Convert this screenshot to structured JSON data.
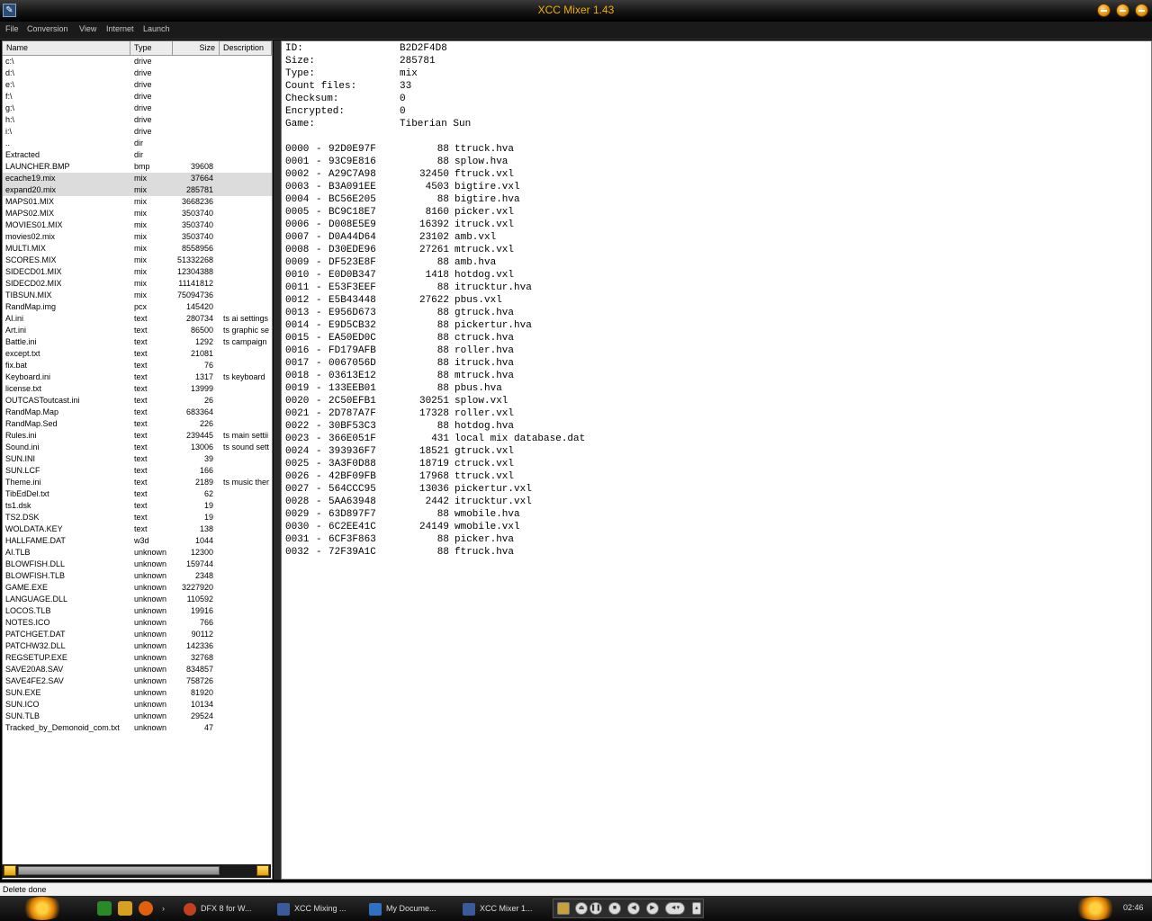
{
  "window": {
    "title": "XCC Mixer 1.43",
    "app_icon": "xcc-app-icon",
    "buttons": [
      "minimize-button",
      "maximize-button",
      "close-button"
    ]
  },
  "menu": [
    "File",
    "Conversion",
    "View",
    "Internet",
    "Launch"
  ],
  "file_list": {
    "columns": [
      "Name",
      "Type",
      "Size",
      "Description"
    ],
    "rows": [
      {
        "name": "c:\\",
        "type": "drive",
        "size": "",
        "desc": ""
      },
      {
        "name": "d:\\",
        "type": "drive",
        "size": "",
        "desc": ""
      },
      {
        "name": "e:\\",
        "type": "drive",
        "size": "",
        "desc": ""
      },
      {
        "name": "f:\\",
        "type": "drive",
        "size": "",
        "desc": ""
      },
      {
        "name": "g:\\",
        "type": "drive",
        "size": "",
        "desc": ""
      },
      {
        "name": "h:\\",
        "type": "drive",
        "size": "",
        "desc": ""
      },
      {
        "name": "i:\\",
        "type": "drive",
        "size": "",
        "desc": ""
      },
      {
        "name": "..",
        "type": "dir",
        "size": "",
        "desc": ""
      },
      {
        "name": "Extracted",
        "type": "dir",
        "size": "",
        "desc": ""
      },
      {
        "name": "LAUNCHER.BMP",
        "type": "bmp",
        "size": "39608",
        "desc": ""
      },
      {
        "name": "ecache19.mix",
        "type": "mix",
        "size": "37664",
        "desc": "",
        "selected": true
      },
      {
        "name": "expand20.mix",
        "type": "mix",
        "size": "285781",
        "desc": "",
        "selected": true
      },
      {
        "name": "MAPS01.MIX",
        "type": "mix",
        "size": "3668236",
        "desc": ""
      },
      {
        "name": "MAPS02.MIX",
        "type": "mix",
        "size": "3503740",
        "desc": ""
      },
      {
        "name": "MOVIES01.MIX",
        "type": "mix",
        "size": "3503740",
        "desc": ""
      },
      {
        "name": "movies02.mix",
        "type": "mix",
        "size": "3503740",
        "desc": ""
      },
      {
        "name": "MULTI.MIX",
        "type": "mix",
        "size": "8558956",
        "desc": ""
      },
      {
        "name": "SCORES.MIX",
        "type": "mix",
        "size": "51332268",
        "desc": ""
      },
      {
        "name": "SIDECD01.MIX",
        "type": "mix",
        "size": "12304388",
        "desc": ""
      },
      {
        "name": "SIDECD02.MIX",
        "type": "mix",
        "size": "11141812",
        "desc": ""
      },
      {
        "name": "TIBSUN.MIX",
        "type": "mix",
        "size": "75094736",
        "desc": ""
      },
      {
        "name": "RandMap.img",
        "type": "pcx",
        "size": "145420",
        "desc": ""
      },
      {
        "name": "AI.ini",
        "type": "text",
        "size": "280734",
        "desc": "ts ai settings"
      },
      {
        "name": "Art.ini",
        "type": "text",
        "size": "86500",
        "desc": "ts graphic se"
      },
      {
        "name": "Battle.ini",
        "type": "text",
        "size": "1292",
        "desc": "ts campaign"
      },
      {
        "name": "except.txt",
        "type": "text",
        "size": "21081",
        "desc": ""
      },
      {
        "name": "fix.bat",
        "type": "text",
        "size": "76",
        "desc": ""
      },
      {
        "name": "Keyboard.ini",
        "type": "text",
        "size": "1317",
        "desc": "ts keyboard"
      },
      {
        "name": "license.txt",
        "type": "text",
        "size": "13999",
        "desc": ""
      },
      {
        "name": "OUTCASToutcast.ini",
        "type": "text",
        "size": "26",
        "desc": ""
      },
      {
        "name": "RandMap.Map",
        "type": "text",
        "size": "683364",
        "desc": ""
      },
      {
        "name": "RandMap.Sed",
        "type": "text",
        "size": "226",
        "desc": ""
      },
      {
        "name": "Rules.ini",
        "type": "text",
        "size": "239445",
        "desc": "ts main settii"
      },
      {
        "name": "Sound.ini",
        "type": "text",
        "size": "13006",
        "desc": "ts sound sett"
      },
      {
        "name": "SUN.INI",
        "type": "text",
        "size": "39",
        "desc": ""
      },
      {
        "name": "SUN.LCF",
        "type": "text",
        "size": "166",
        "desc": ""
      },
      {
        "name": "Theme.ini",
        "type": "text",
        "size": "2189",
        "desc": "ts music ther"
      },
      {
        "name": "TibEdDel.txt",
        "type": "text",
        "size": "62",
        "desc": ""
      },
      {
        "name": "ts1.dsk",
        "type": "text",
        "size": "19",
        "desc": ""
      },
      {
        "name": "TS2.DSK",
        "type": "text",
        "size": "19",
        "desc": ""
      },
      {
        "name": "WOLDATA.KEY",
        "type": "text",
        "size": "138",
        "desc": ""
      },
      {
        "name": "HALLFAME.DAT",
        "type": "w3d",
        "size": "1044",
        "desc": ""
      },
      {
        "name": "AI.TLB",
        "type": "unknown",
        "size": "12300",
        "desc": ""
      },
      {
        "name": "BLOWFISH.DLL",
        "type": "unknown",
        "size": "159744",
        "desc": ""
      },
      {
        "name": "BLOWFISH.TLB",
        "type": "unknown",
        "size": "2348",
        "desc": ""
      },
      {
        "name": "GAME.EXE",
        "type": "unknown",
        "size": "3227920",
        "desc": ""
      },
      {
        "name": "LANGUAGE.DLL",
        "type": "unknown",
        "size": "110592",
        "desc": ""
      },
      {
        "name": "LOCOS.TLB",
        "type": "unknown",
        "size": "19916",
        "desc": ""
      },
      {
        "name": "NOTES.ICO",
        "type": "unknown",
        "size": "766",
        "desc": ""
      },
      {
        "name": "PATCHGET.DAT",
        "type": "unknown",
        "size": "90112",
        "desc": ""
      },
      {
        "name": "PATCHW32.DLL",
        "type": "unknown",
        "size": "142336",
        "desc": ""
      },
      {
        "name": "REGSETUP.EXE",
        "type": "unknown",
        "size": "32768",
        "desc": ""
      },
      {
        "name": "SAVE20A8.SAV",
        "type": "unknown",
        "size": "834857",
        "desc": ""
      },
      {
        "name": "SAVE4FE2.SAV",
        "type": "unknown",
        "size": "758726",
        "desc": ""
      },
      {
        "name": "SUN.EXE",
        "type": "unknown",
        "size": "81920",
        "desc": ""
      },
      {
        "name": "SUN.ICO",
        "type": "unknown",
        "size": "10134",
        "desc": ""
      },
      {
        "name": "SUN.TLB",
        "type": "unknown",
        "size": "29524",
        "desc": ""
      },
      {
        "name": "Tracked_by_Demonoid_com.txt",
        "type": "unknown",
        "size": "47",
        "desc": ""
      }
    ]
  },
  "details": {
    "info": [
      {
        "label": "ID:",
        "value": "B2D2F4D8"
      },
      {
        "label": "Size:",
        "value": "285781"
      },
      {
        "label": "Type:",
        "value": "mix"
      },
      {
        "label": "Count files:",
        "value": "33"
      },
      {
        "label": "Checksum:",
        "value": "0"
      },
      {
        "label": "Encrypted:",
        "value": "0"
      },
      {
        "label": "Game:",
        "value": "Tiberian Sun"
      }
    ],
    "entries": [
      {
        "idx": "0000",
        "id": "92D0E97F",
        "size": "88",
        "name": "ttruck.hva"
      },
      {
        "idx": "0001",
        "id": "93C9E816",
        "size": "88",
        "name": "splow.hva"
      },
      {
        "idx": "0002",
        "id": "A29C7A98",
        "size": "32450",
        "name": "ftruck.vxl"
      },
      {
        "idx": "0003",
        "id": "B3A091EE",
        "size": "4503",
        "name": "bigtire.vxl"
      },
      {
        "idx": "0004",
        "id": "BC56E205",
        "size": "88",
        "name": "bigtire.hva"
      },
      {
        "idx": "0005",
        "id": "BC9C18E7",
        "size": "8160",
        "name": "picker.vxl"
      },
      {
        "idx": "0006",
        "id": "D008E5E9",
        "size": "16392",
        "name": "itruck.vxl"
      },
      {
        "idx": "0007",
        "id": "D0A44D64",
        "size": "23102",
        "name": "amb.vxl"
      },
      {
        "idx": "0008",
        "id": "D30EDE96",
        "size": "27261",
        "name": "mtruck.vxl"
      },
      {
        "idx": "0009",
        "id": "DF523E8F",
        "size": "88",
        "name": "amb.hva"
      },
      {
        "idx": "0010",
        "id": "E0D0B347",
        "size": "1418",
        "name": "hotdog.vxl"
      },
      {
        "idx": "0011",
        "id": "E53F3EEF",
        "size": "88",
        "name": "itrucktur.hva"
      },
      {
        "idx": "0012",
        "id": "E5B43448",
        "size": "27622",
        "name": "pbus.vxl"
      },
      {
        "idx": "0013",
        "id": "E956D673",
        "size": "88",
        "name": "gtruck.hva"
      },
      {
        "idx": "0014",
        "id": "E9D5CB32",
        "size": "88",
        "name": "pickertur.hva"
      },
      {
        "idx": "0015",
        "id": "EA50ED0C",
        "size": "88",
        "name": "ctruck.hva"
      },
      {
        "idx": "0016",
        "id": "FD179AFB",
        "size": "88",
        "name": "roller.hva"
      },
      {
        "idx": "0017",
        "id": "0067056D",
        "size": "88",
        "name": "itruck.hva"
      },
      {
        "idx": "0018",
        "id": "03613E12",
        "size": "88",
        "name": "mtruck.hva"
      },
      {
        "idx": "0019",
        "id": "133EEB01",
        "size": "88",
        "name": "pbus.hva"
      },
      {
        "idx": "0020",
        "id": "2C50EFB1",
        "size": "30251",
        "name": "splow.vxl"
      },
      {
        "idx": "0021",
        "id": "2D787A7F",
        "size": "17328",
        "name": "roller.vxl"
      },
      {
        "idx": "0022",
        "id": "30BF53C3",
        "size": "88",
        "name": "hotdog.hva"
      },
      {
        "idx": "0023",
        "id": "366E051F",
        "size": "431",
        "name": "local mix database.dat"
      },
      {
        "idx": "0024",
        "id": "393936F7",
        "size": "18521",
        "name": "gtruck.vxl"
      },
      {
        "idx": "0025",
        "id": "3A3F0D88",
        "size": "18719",
        "name": "ctruck.vxl"
      },
      {
        "idx": "0026",
        "id": "42BF09FB",
        "size": "17968",
        "name": "ttruck.vxl"
      },
      {
        "idx": "0027",
        "id": "564CCC95",
        "size": "13036",
        "name": "pickertur.vxl"
      },
      {
        "idx": "0028",
        "id": "5AA63948",
        "size": "2442",
        "name": "itrucktur.vxl"
      },
      {
        "idx": "0029",
        "id": "63D897F7",
        "size": "88",
        "name": "wmobile.hva"
      },
      {
        "idx": "0030",
        "id": "6C2EE41C",
        "size": "24149",
        "name": "wmobile.vxl"
      },
      {
        "idx": "0031",
        "id": "6CF3F863",
        "size": "88",
        "name": "picker.hva"
      },
      {
        "idx": "0032",
        "id": "72F39A1C",
        "size": "88",
        "name": "ftruck.hva"
      }
    ]
  },
  "status": "Delete done",
  "taskbar": {
    "tasks": [
      {
        "label": "DFX 8 for W...",
        "icon": "dfx-icon",
        "color": "#c04020"
      },
      {
        "label": "XCC Mixing ...",
        "icon": "xcc-icon",
        "color": "#3a5a9a"
      },
      {
        "label": "My Docume...",
        "icon": "folder-icon",
        "color": "#3070c0"
      },
      {
        "label": "XCC Mixer 1...",
        "icon": "xcc-icon",
        "color": "#3a5a9a"
      }
    ],
    "clock": "02:46"
  },
  "colors": {
    "title_text": "#f0b000",
    "accent": "#e89000"
  }
}
